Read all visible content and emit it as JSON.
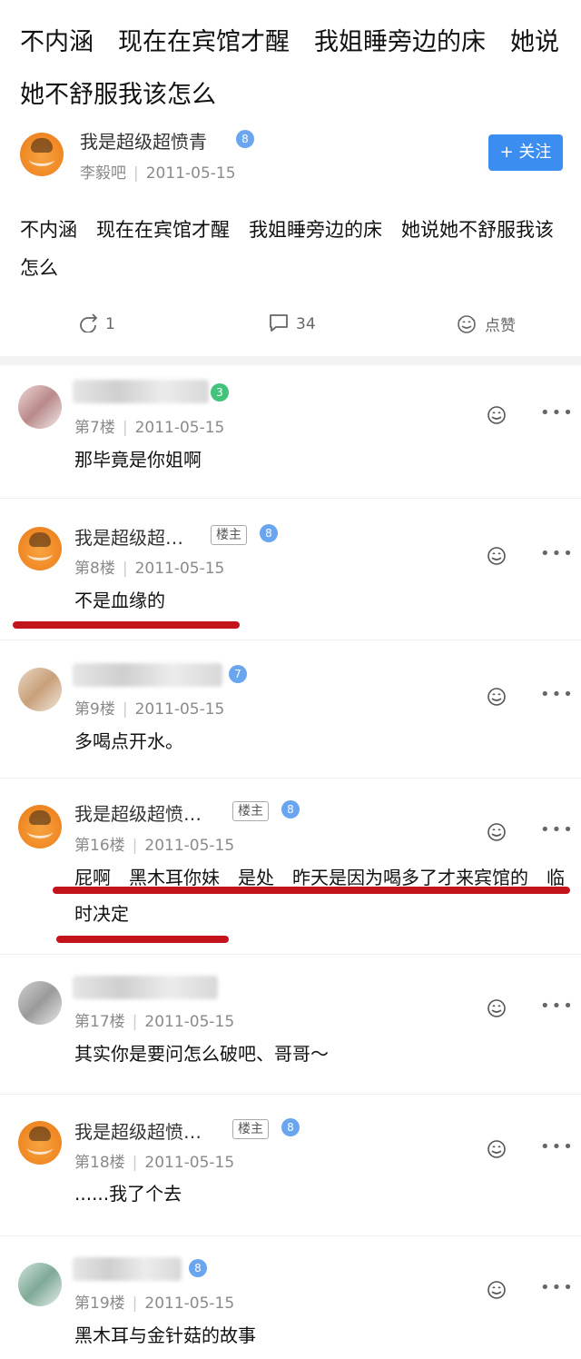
{
  "post": {
    "title": "不内涵　现在在宾馆才醒　我姐睡旁边的床　她说她不舒服我该怎么",
    "author": "我是超级超愤青",
    "level": "8",
    "forum": "李毅吧",
    "date": "2011-05-15",
    "follow_label": "+ 关注",
    "body": "不内涵　现在在宾馆才醒　我姐睡旁边的床　她说她不舒服我该怎么",
    "share_count": "1",
    "comment_count": "34",
    "like_label": "点赞"
  },
  "louzhu_label": "楼主",
  "comments": [
    {
      "floor": "第7楼",
      "date": "2011-05-15",
      "text": "那毕竟是你姐啊",
      "level": "3",
      "author": ""
    },
    {
      "floor": "第8楼",
      "date": "2011-05-15",
      "text": "不是血缘的",
      "level": "8",
      "author": "我是超级超…"
    },
    {
      "floor": "第9楼",
      "date": "2011-05-15",
      "text": "多喝点开水。",
      "level": "7",
      "author": ""
    },
    {
      "floor": "第16楼",
      "date": "2011-05-15",
      "text": "屁啊　黑木耳你妹　是处　昨天是因为喝多了才来宾馆的　临时决定",
      "level": "8",
      "author": "我是超级超愤…"
    },
    {
      "floor": "第17楼",
      "date": "2011-05-15",
      "text": "其实你是要问怎么破吧、哥哥～",
      "level": "",
      "author": ""
    },
    {
      "floor": "第18楼",
      "date": "2011-05-15",
      "text": "......我了个去",
      "level": "8",
      "author": "我是超级超愤…"
    },
    {
      "floor": "第19楼",
      "date": "2011-05-15",
      "text": "黑木耳与金针菇的故事",
      "level": "8",
      "author": ""
    }
  ]
}
